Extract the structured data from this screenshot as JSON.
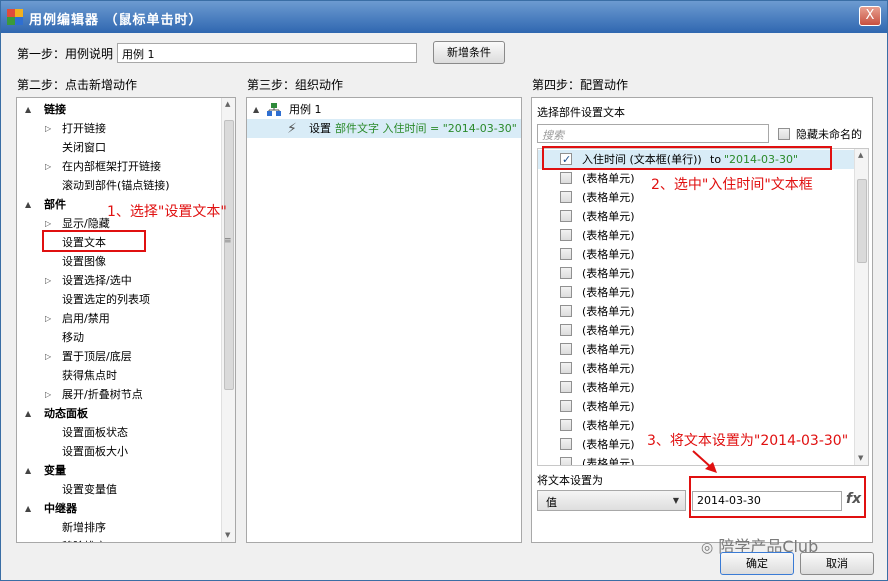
{
  "window": {
    "title": "用例编辑器 （鼠标单击时）",
    "close_label": "X",
    "brand_colors": [
      "#e04b3c",
      "#f2b01e",
      "#3b9a3b",
      "#2f6fd1"
    ]
  },
  "step1": {
    "label": "第一步：用例说明",
    "input_value": "用例 1",
    "add_condition_button": "新增条件"
  },
  "step2": {
    "label": "第二步：点击新增动作",
    "items": [
      {
        "text": "链接",
        "kind": "group",
        "tri": "▲"
      },
      {
        "text": "打开链接",
        "kind": "child",
        "tri": "▷"
      },
      {
        "text": "关闭窗口",
        "kind": "child",
        "tri": ""
      },
      {
        "text": "在内部框架打开链接",
        "kind": "child",
        "tri": "▷"
      },
      {
        "text": "滚动到部件(锚点链接)",
        "kind": "child",
        "tri": ""
      },
      {
        "text": "部件",
        "kind": "group",
        "tri": "▲"
      },
      {
        "text": "显示/隐藏",
        "kind": "child",
        "tri": "▷"
      },
      {
        "text": "设置文本",
        "kind": "child",
        "tri": ""
      },
      {
        "text": "设置图像",
        "kind": "child",
        "tri": ""
      },
      {
        "text": "设置选择/选中",
        "kind": "child",
        "tri": "▷"
      },
      {
        "text": "设置选定的列表项",
        "kind": "child",
        "tri": ""
      },
      {
        "text": "启用/禁用",
        "kind": "child",
        "tri": "▷"
      },
      {
        "text": "移动",
        "kind": "child",
        "tri": ""
      },
      {
        "text": "置于顶层/底层",
        "kind": "child",
        "tri": "▷"
      },
      {
        "text": "获得焦点时",
        "kind": "child",
        "tri": ""
      },
      {
        "text": "展开/折叠树节点",
        "kind": "child",
        "tri": "▷"
      },
      {
        "text": "动态面板",
        "kind": "group",
        "tri": "▲"
      },
      {
        "text": "设置面板状态",
        "kind": "child",
        "tri": ""
      },
      {
        "text": "设置面板大小",
        "kind": "child",
        "tri": ""
      },
      {
        "text": "变量",
        "kind": "group",
        "tri": "▲"
      },
      {
        "text": "设置变量值",
        "kind": "child",
        "tri": ""
      },
      {
        "text": "中继器",
        "kind": "group",
        "tri": "▲"
      },
      {
        "text": "新增排序",
        "kind": "child",
        "tri": ""
      },
      {
        "text": "移除排序",
        "kind": "child",
        "tri": ""
      }
    ]
  },
  "step3": {
    "label": "第三步：组织动作",
    "case_label": "用例 1",
    "action_prefix": "设置",
    "action_detail": "部件文字 入住时间 = \"2014-03-30\""
  },
  "step4": {
    "label": "第四步：配置动作",
    "subtitle": "选择部件设置文本",
    "search_placeholder": "搜索",
    "hide_unnamed_label": "隐藏未命名的",
    "first_item": {
      "name": "入住时间 (文本框(单行))",
      "to": "to",
      "value": "\"2014-03-30\""
    },
    "cell_label": "(表格单元)",
    "cell_count": 16,
    "set_text_label": "将文本设置为",
    "type_select_value": "值",
    "value_input": "2014-03-30",
    "fx_label": "fx"
  },
  "annotations": {
    "a1": "1、选择\"设置文本\"",
    "a2": "2、选中\"入住时间\"文本框",
    "a3": "3、将文本设置为\"2014-03-30\""
  },
  "watermark": "陪学产品Club",
  "footer": {
    "ok_button": "确定",
    "cancel_button": "取消"
  }
}
